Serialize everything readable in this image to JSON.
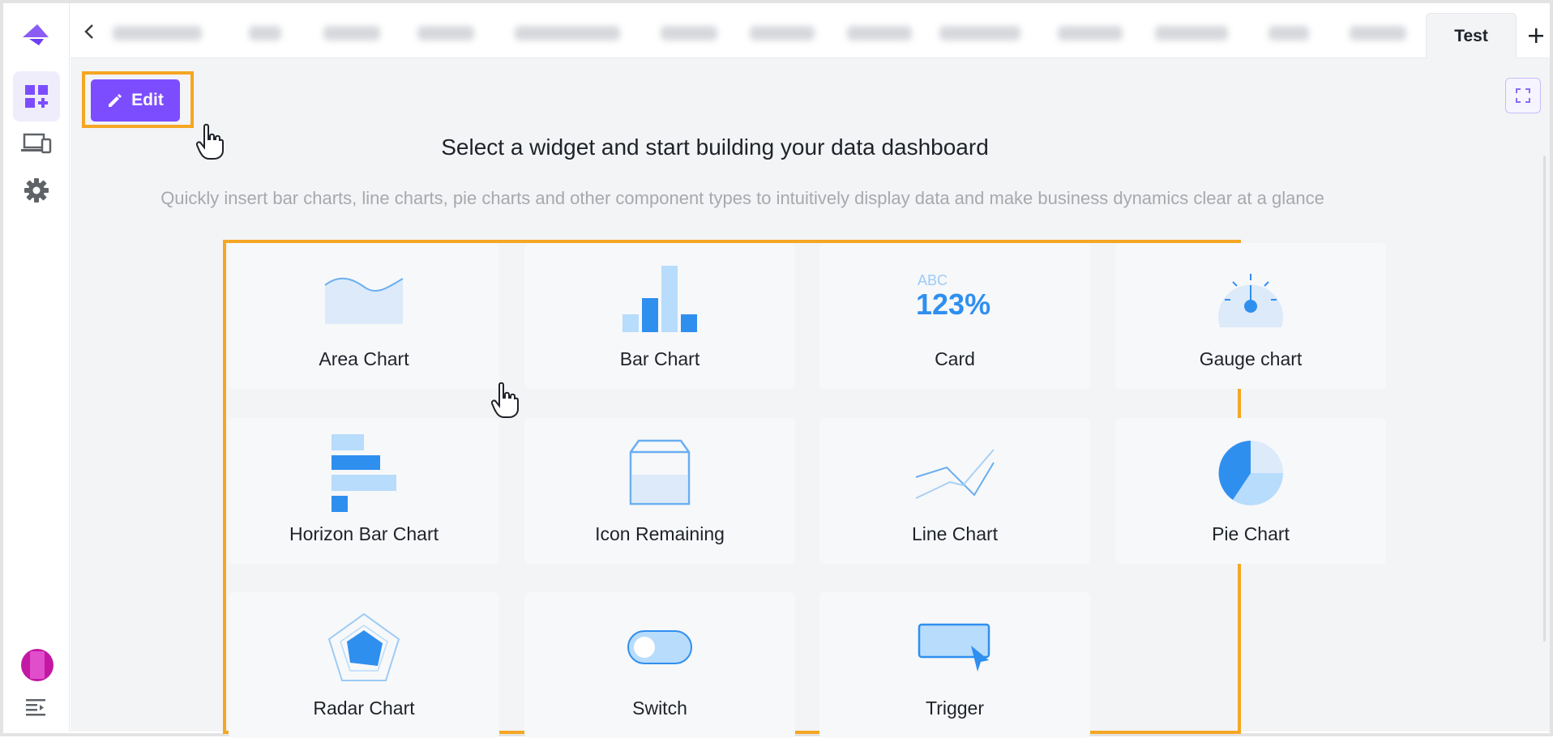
{
  "tabs": {
    "active_tab": "Test"
  },
  "toolbar": {
    "edit_label": "Edit"
  },
  "main": {
    "headline": "Select a widget and start building your data dashboard",
    "subline": "Quickly insert bar charts, line charts, pie charts and other component types to intuitively display data and make business dynamics clear at a glance"
  },
  "widgets": [
    {
      "label": "Area Chart",
      "icon": "area-chart-icon"
    },
    {
      "label": "Bar Chart",
      "icon": "bar-chart-icon"
    },
    {
      "label": "Card",
      "icon": "card-icon",
      "icon_text_top": "ABC",
      "icon_text_main": "123%"
    },
    {
      "label": "Gauge chart",
      "icon": "gauge-icon"
    },
    {
      "label": "Horizon Bar Chart",
      "icon": "horizontal-bar-icon"
    },
    {
      "label": "Icon Remaining",
      "icon": "box-remaining-icon"
    },
    {
      "label": "Line Chart",
      "icon": "line-chart-icon"
    },
    {
      "label": "Pie Chart",
      "icon": "pie-chart-icon"
    },
    {
      "label": "Radar Chart",
      "icon": "radar-chart-icon"
    },
    {
      "label": "Switch",
      "icon": "toggle-switch-icon"
    },
    {
      "label": "Trigger",
      "icon": "trigger-icon"
    }
  ],
  "colors": {
    "accent": "#7c4dff",
    "highlight": "#f5a623",
    "icon_blue": "#2f8fef",
    "icon_light": "#b8dcfb"
  }
}
